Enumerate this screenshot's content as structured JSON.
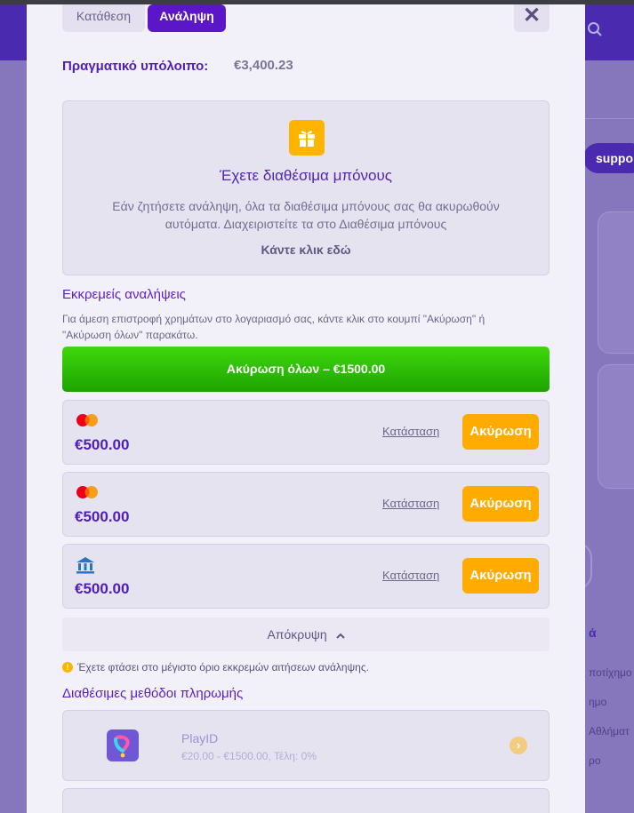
{
  "background": {
    "search_icon": "search-icon",
    "pill_label": "suppo",
    "side_heading": "ά",
    "side_items": [
      "ποτίχημο",
      "ημο",
      "Αθλήματ",
      "ρο"
    ]
  },
  "tabs": {
    "deposit_label": "Κατάθεση",
    "withdraw_label": "Ανάληψη"
  },
  "close_glyph": "✕",
  "balance": {
    "label": "Πραγματικό υπόλοιπο:",
    "value": "€3,400.23"
  },
  "bonus": {
    "icon": "gift-icon",
    "title": "Έχετε διαθέσιμα μπόνους",
    "description": "Εάν ζητήσετε ανάληψη, όλα τα διαθέσιμα μπόνους σας θα ακυρωθούν αυτόματα. Διαχειριστείτε τα στο Διαθέσιμα μπόνους",
    "link": "Κάντε κλικ εδώ"
  },
  "pending": {
    "title": "Εκκρεμείς αναλήψεις",
    "note": "Για άμεση επιστροφή χρημάτων στο λογαριασμό σας, κάντε κλικ στο κουμπί \"Ακύρωση\" ή \"Ακύρωση όλων\" παρακάτω.",
    "cancel_all_label": "Ακύρωση όλων – €1500.00",
    "rows": [
      {
        "icon": "mastercard-icon",
        "amount": "€500.00",
        "status_label": "Κατάσταση",
        "cancel_label": "Ακύρωση"
      },
      {
        "icon": "mastercard-icon",
        "amount": "€500.00",
        "status_label": "Κατάσταση",
        "cancel_label": "Ακύρωση"
      },
      {
        "icon": "bank-icon",
        "amount": "€500.00",
        "status_label": "Κατάσταση",
        "cancel_label": "Ακύρωση"
      }
    ],
    "hide_label": "Απόκρυψη"
  },
  "limit_notice": "Έχετε φτάσει στο μέγιστο όριο εκκρεμών αιτήσεων ανάληψης.",
  "methods": {
    "title": "Διαθέσιμες μεθόδοι πληρωμής",
    "items": [
      {
        "icon": "playid-icon",
        "name": "PlayID",
        "limits": "€20.00 - €1500.00, Τέλη: 0%"
      }
    ]
  },
  "colors": {
    "accent": "#5b16c7",
    "cancel": "#ffab00",
    "success": "#2ebd06"
  }
}
